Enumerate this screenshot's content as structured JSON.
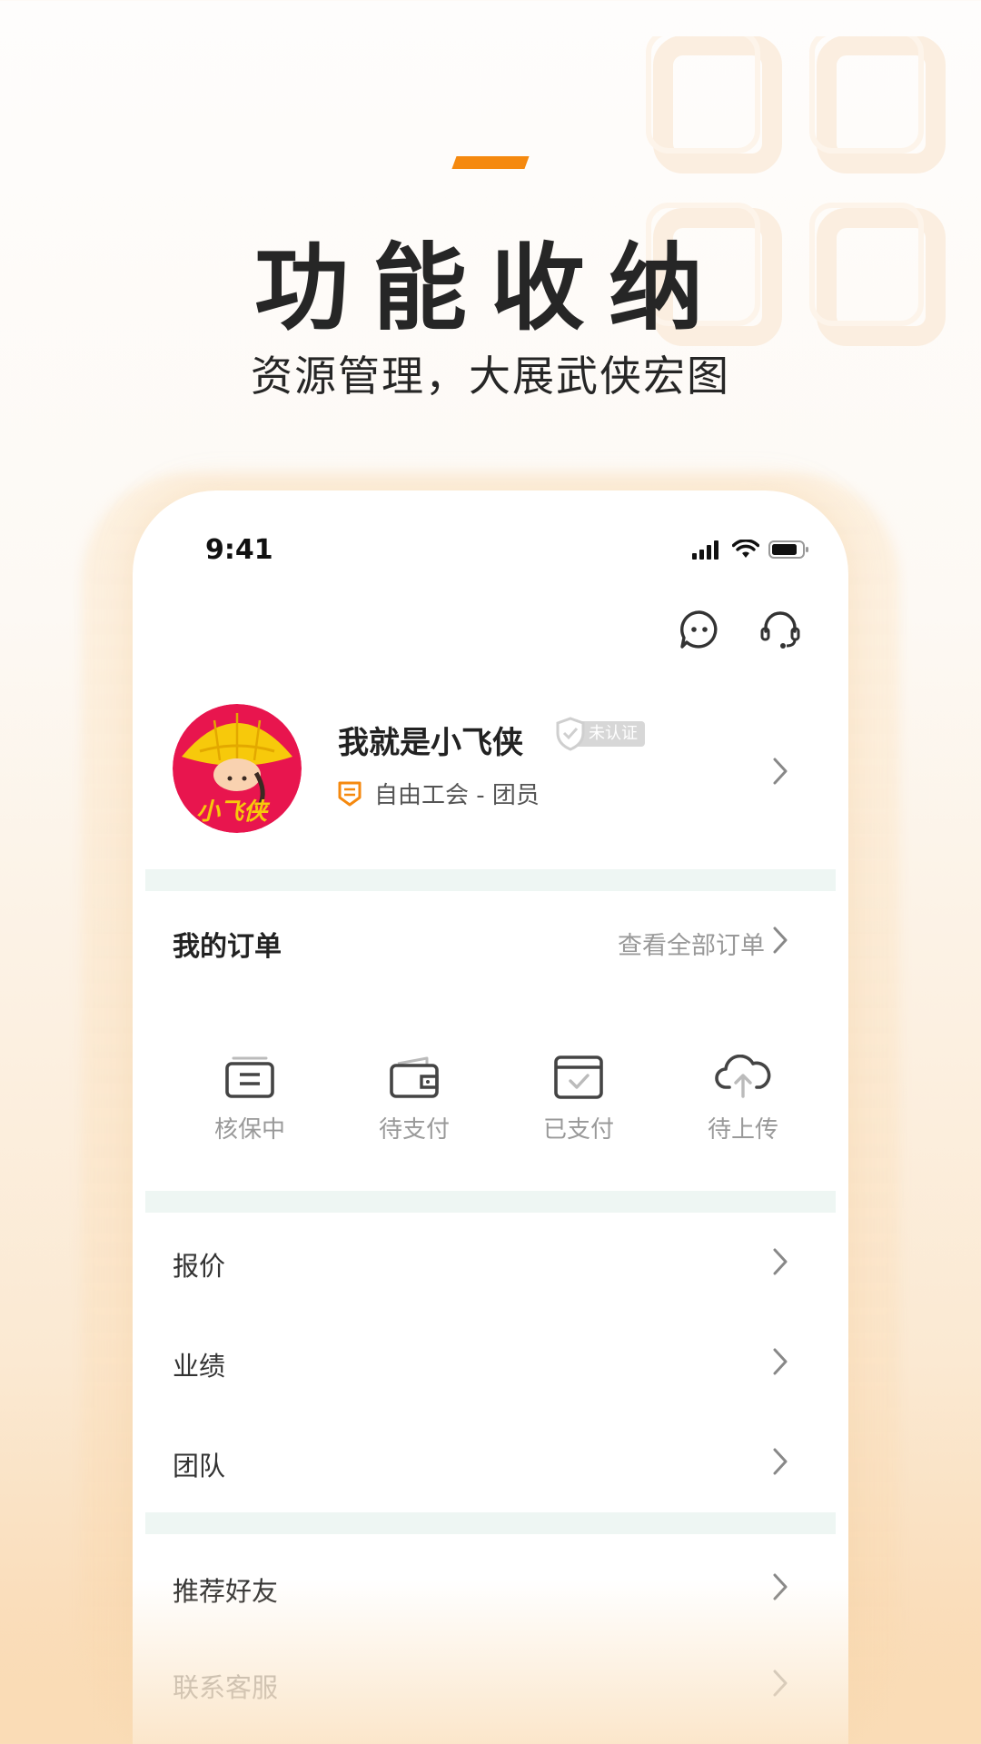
{
  "promo": {
    "headline": "功能收纳",
    "subhead": "资源管理，大展武侠宏图",
    "accent_color": "#f5890f"
  },
  "statusbar": {
    "time": "9:41",
    "icons": [
      "signal-icon",
      "wifi-icon",
      "battery-icon"
    ]
  },
  "top_actions": [
    "message-icon",
    "headset-icon"
  ],
  "profile": {
    "name": "我就是小飞侠",
    "verify_badge": "未认证",
    "avatar_text": "小飞侠",
    "guild": "自由工会 - 团员"
  },
  "orders": {
    "title": "我的订单",
    "view_all": "查看全部订单",
    "items": [
      {
        "label": "核保中",
        "icon": "document-icon"
      },
      {
        "label": "待支付",
        "icon": "wallet-icon"
      },
      {
        "label": "已支付",
        "icon": "paid-check-icon"
      },
      {
        "label": "待上传",
        "icon": "cloud-upload-icon"
      }
    ]
  },
  "menu_group_1": [
    "报价",
    "业绩",
    "团队"
  ],
  "menu_group_2": [
    "推荐好友",
    "联系客服"
  ]
}
